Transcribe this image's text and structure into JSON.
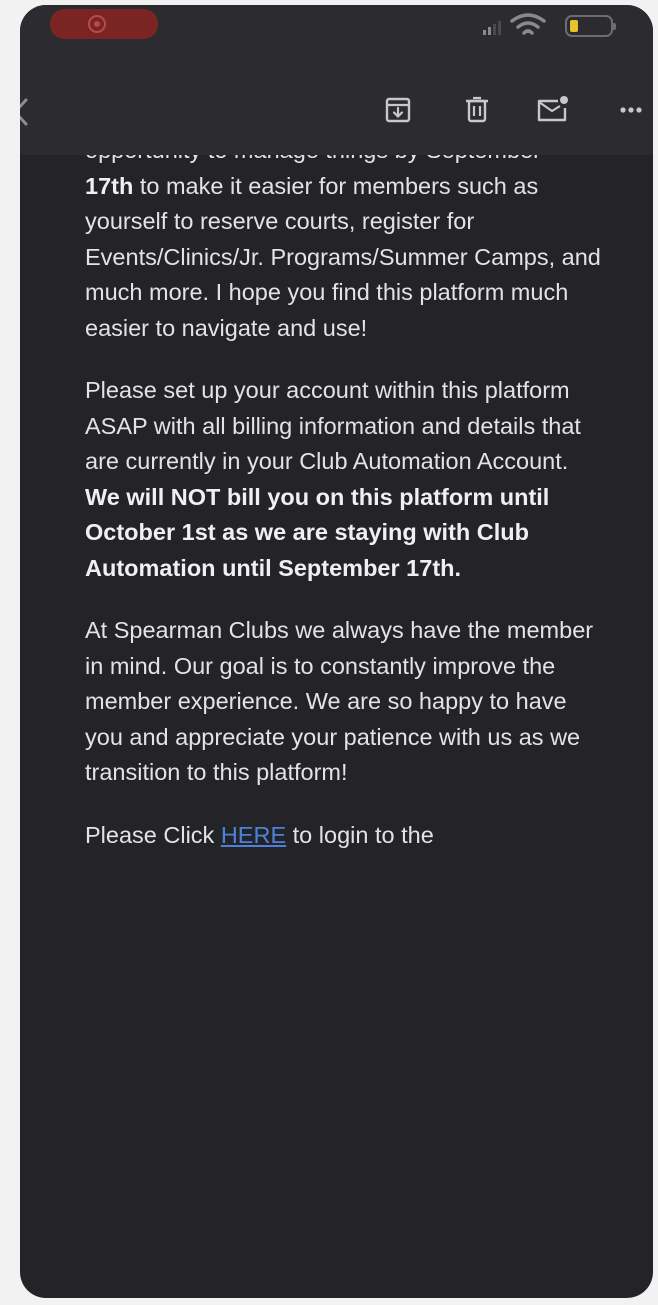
{
  "email": {
    "cut_top_line": "opportunity to manage things by September",
    "p1": {
      "bold_lead": "17th",
      "rest": " to make it easier for members such as yourself to reserve courts, register for Events/Clinics/Jr. Programs/Summer Camps, and much more. I hope you find this platform much easier to navigate and use!"
    },
    "p2": {
      "text": "Please set up your account within this platform ASAP with all billing information and details that are currently in your Club Automation Account. ",
      "bold": "We will NOT bill you on this platform until October 1st as we are staying with Club Automation until September 17th."
    },
    "p3": "At Spearman Clubs we always have the member in mind. Our goal is to constantly improve the member experience. We are so happy to have you and appreciate your patience with us as we transition to this platform!",
    "p4": {
      "before": "Please Click ",
      "link": "HERE",
      "after": " to login to the"
    }
  },
  "icons": {
    "status": [
      "screen-record-icon",
      "signal-icon",
      "wifi-icon",
      "battery-icon"
    ],
    "toolbar": [
      "back-chevron-icon",
      "archive-icon",
      "trash-icon",
      "mark-unread-icon",
      "more-icon"
    ]
  },
  "colors": {
    "background": "#242428",
    "toolbar": "#2c2c30",
    "text": "#e3e3e3",
    "link": "#4a83d8",
    "battery": "#e6c52a",
    "record": "#7a2424"
  }
}
